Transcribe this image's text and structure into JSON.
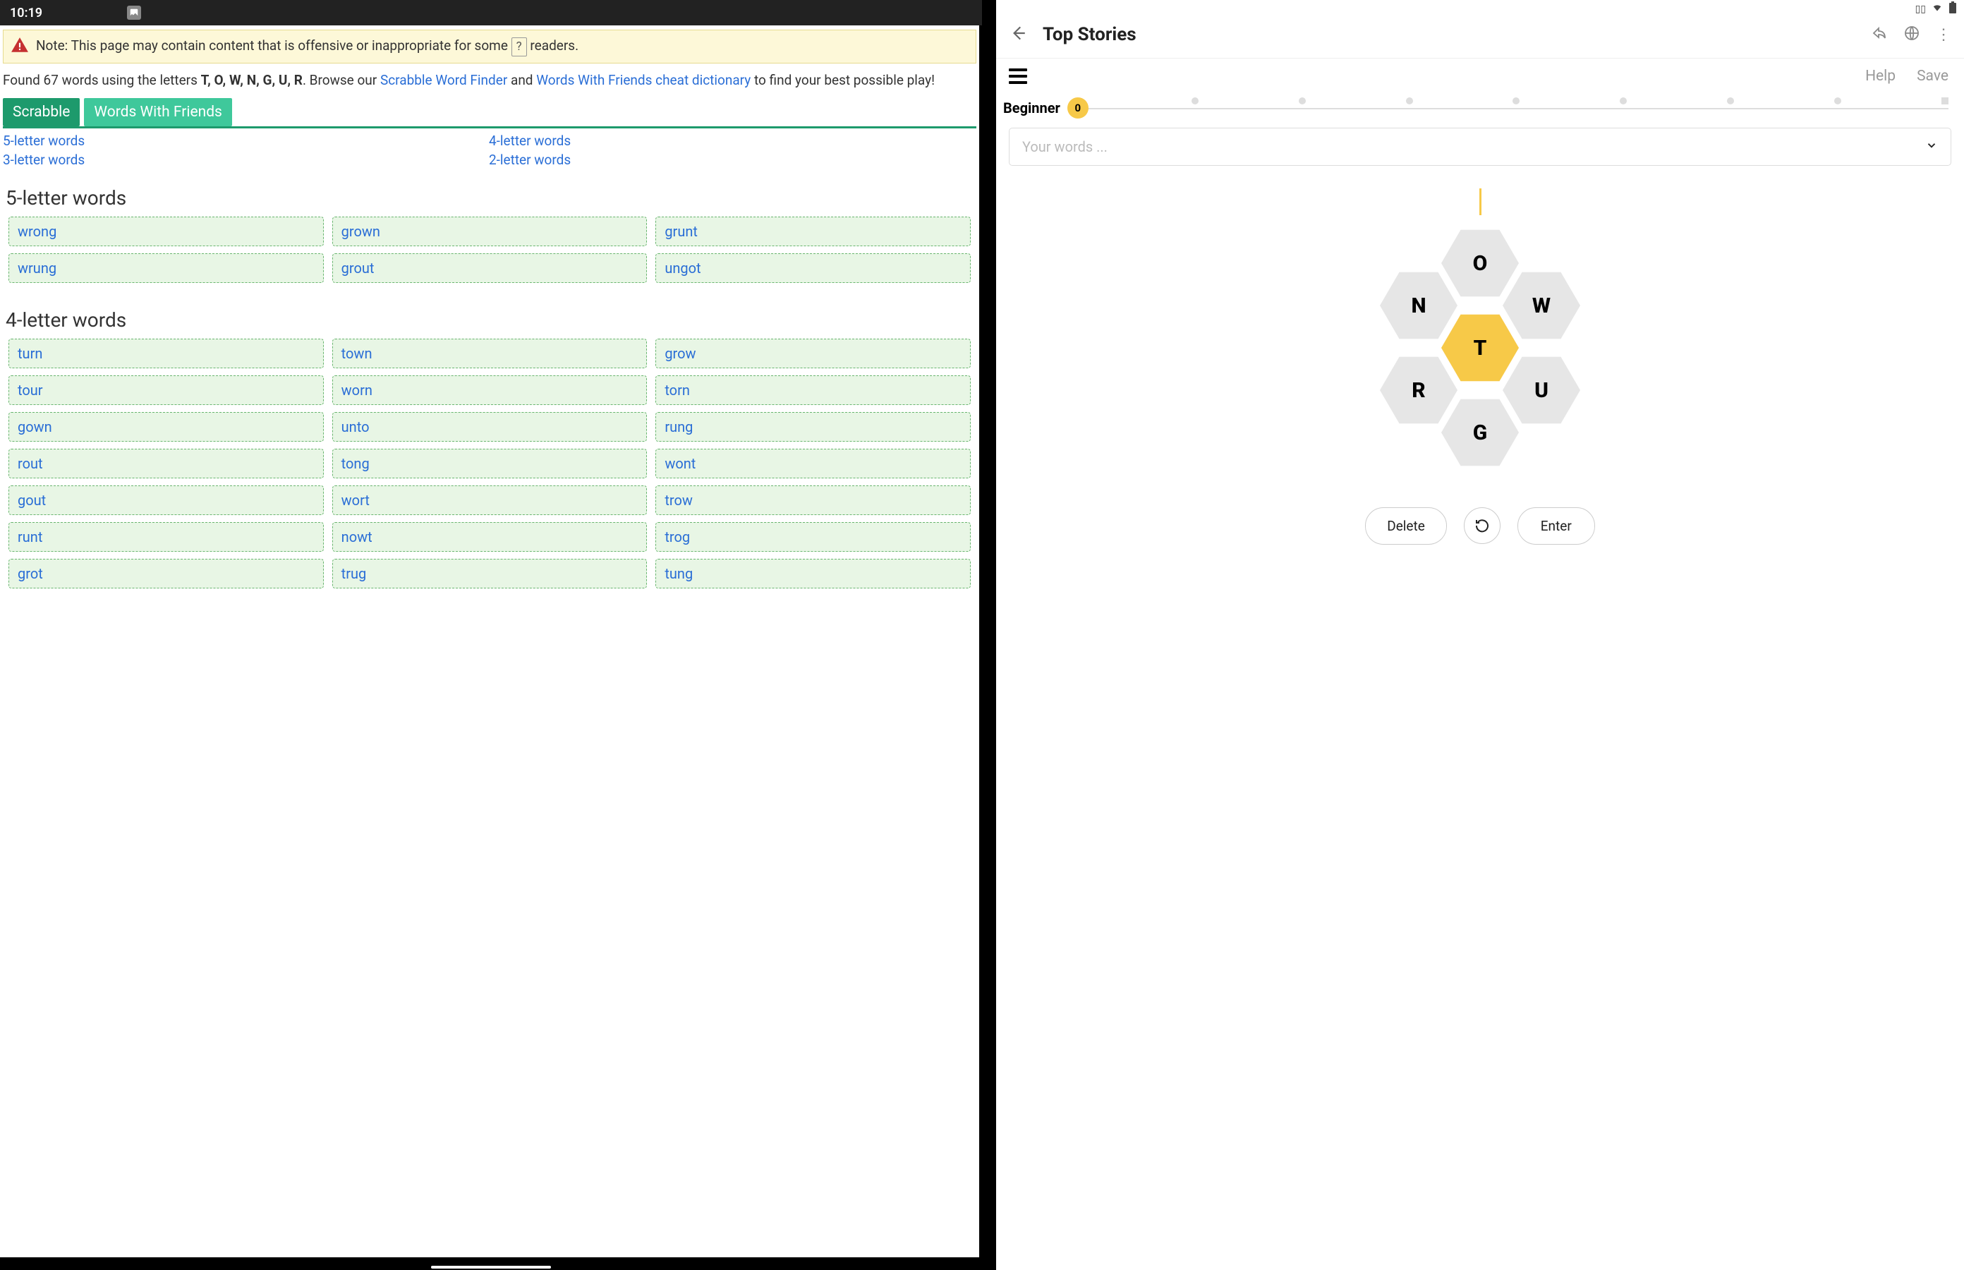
{
  "left": {
    "status_time": "10:19",
    "warning_text_a": "Note: This page may contain content that is offensive or inappropriate for some",
    "warning_help": "?",
    "warning_text_b": "readers.",
    "found_prefix": "Found 67 words using the letters ",
    "found_letters": "T, O, W, N, G, U, R",
    "found_mid": ". Browse our ",
    "link_swf": "Scrabble Word Finder",
    "found_and": " and ",
    "link_wwf_dict": "Words With Friends cheat dictionary",
    "found_suffix": " to find your best possible play!",
    "tabs": {
      "scrabble": "Scrabble",
      "wwf": "Words With Friends"
    },
    "jumps": {
      "l5": "5-letter words",
      "l4": "4-letter words",
      "l3": "3-letter words",
      "l2": "2-letter words"
    },
    "sections": [
      {
        "heading": "5-letter words",
        "words": [
          "wrong",
          "grown",
          "grunt",
          "wrung",
          "grout",
          "ungot"
        ]
      },
      {
        "heading": "4-letter words",
        "words": [
          "turn",
          "town",
          "grow",
          "tour",
          "worn",
          "torn",
          "gown",
          "unto",
          "rung",
          "rout",
          "tong",
          "wont",
          "gout",
          "wort",
          "trow",
          "runt",
          "nowt",
          "trog",
          "grot",
          "trug",
          "tung"
        ]
      }
    ]
  },
  "right": {
    "title": "Top Stories",
    "help": "Help",
    "save": "Save",
    "rank": "Beginner",
    "score": "0",
    "placeholder": "Your words ...",
    "hive": {
      "top": "O",
      "tl": "N",
      "tr": "W",
      "center": "T",
      "bl": "R",
      "br": "U",
      "bottom": "G"
    },
    "buttons": {
      "delete": "Delete",
      "enter": "Enter"
    }
  }
}
